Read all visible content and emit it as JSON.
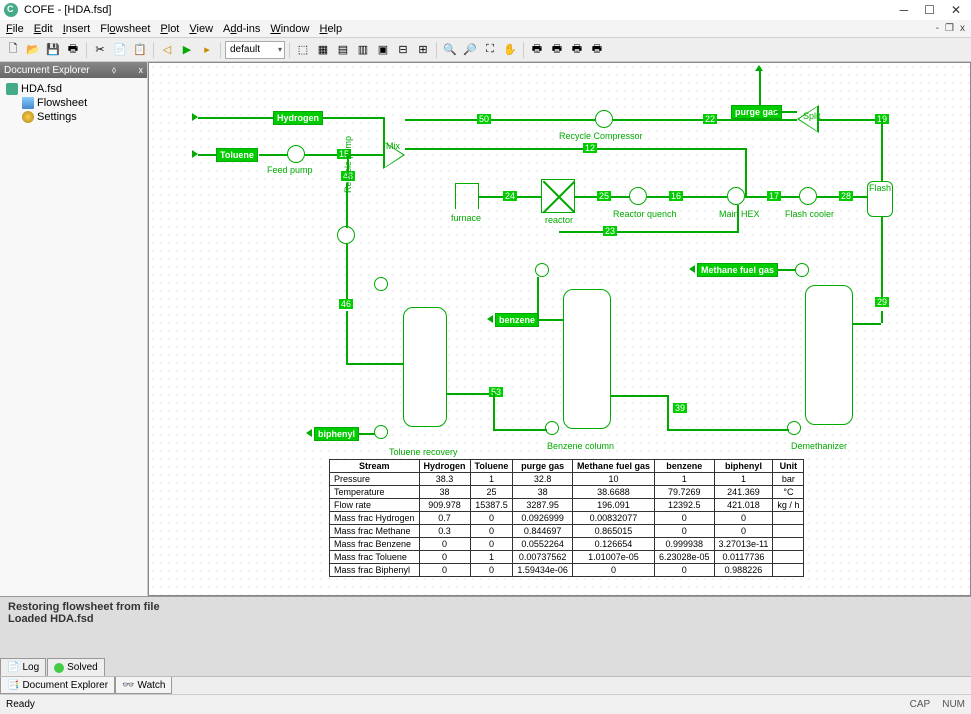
{
  "window": {
    "title": "COFE - [HDA.fsd]"
  },
  "menu": [
    "File",
    "Edit",
    "Insert",
    "Flowsheet",
    "Plot",
    "View",
    "Add-ins",
    "Window",
    "Help"
  ],
  "toolbar_dropdown": "default",
  "doc_explorer": {
    "title": "Document Explorer",
    "root": "HDA.fsd",
    "children": [
      "Flowsheet",
      "Settings"
    ]
  },
  "streams": {
    "hydrogen": "Hydrogen",
    "toluene": "Toluene",
    "purge": "purge gas",
    "methane": "Methane fuel gas",
    "benzene": "benzene",
    "biphenyl": "biphenyl"
  },
  "stream_nums": {
    "s50": "50",
    "s22": "22",
    "s19": "19",
    "s15": "15",
    "s12": "12",
    "s48": "48",
    "s24": "24",
    "s25": "25",
    "s16": "16",
    "s17": "17",
    "s28": "28",
    "s23": "23",
    "s46": "46",
    "s53": "53",
    "s39": "39",
    "s29": "29"
  },
  "units": {
    "feed_pump": "Feed pump",
    "recycle_pump": "Recycle pump",
    "mix": "Mix",
    "recycle_comp": "Recycle Compressor",
    "split": "Split",
    "furnace": "furnace",
    "reactor": "reactor",
    "quench": "Reactor quench",
    "main_hex": "Main HEX",
    "flash_cooler": "Flash cooler",
    "flash": "Flash",
    "toluene_rec": "Toluene recovery",
    "benzene_col": "Benzene column",
    "demeth": "Demethanizer"
  },
  "table": {
    "headers": [
      "Stream",
      "Hydrogen",
      "Toluene",
      "purge gas",
      "Methane fuel gas",
      "benzene",
      "biphenyl",
      "Unit"
    ],
    "rows": [
      [
        "Pressure",
        "38.3",
        "1",
        "32.8",
        "10",
        "1",
        "1",
        "bar"
      ],
      [
        "Temperature",
        "38",
        "25",
        "38",
        "38.6688",
        "79.7269",
        "241.369",
        "°C"
      ],
      [
        "Flow rate",
        "909.978",
        "15387.5",
        "3287.95",
        "196.091",
        "12392.5",
        "421.018",
        "kg / h"
      ],
      [
        "Mass frac Hydrogen",
        "0.7",
        "0",
        "0.0926999",
        "0.00832077",
        "0",
        "0",
        ""
      ],
      [
        "Mass frac Methane",
        "0.3",
        "0",
        "0.844697",
        "0.865015",
        "0",
        "0",
        ""
      ],
      [
        "Mass frac Benzene",
        "0",
        "0",
        "0.0552264",
        "0.126654",
        "0.999938",
        "3.27013e-11",
        ""
      ],
      [
        "Mass frac Toluene",
        "0",
        "1",
        "0.00737562",
        "1.01007e-05",
        "6.23028e-05",
        "0.0117736",
        ""
      ],
      [
        "Mass frac Biphenyl",
        "0",
        "0",
        "1.59434e-06",
        "0",
        "0",
        "0.988226",
        ""
      ]
    ]
  },
  "log": {
    "line1": "Restoring flowsheet from file",
    "line2": "Loaded HDA.fsd"
  },
  "bottom_tabs": {
    "log": "Log",
    "solved": "Solved"
  },
  "side_tabs": {
    "doc": "Document Explorer",
    "watch": "Watch"
  },
  "status": {
    "ready": "Ready",
    "cap": "CAP",
    "num": "NUM"
  }
}
